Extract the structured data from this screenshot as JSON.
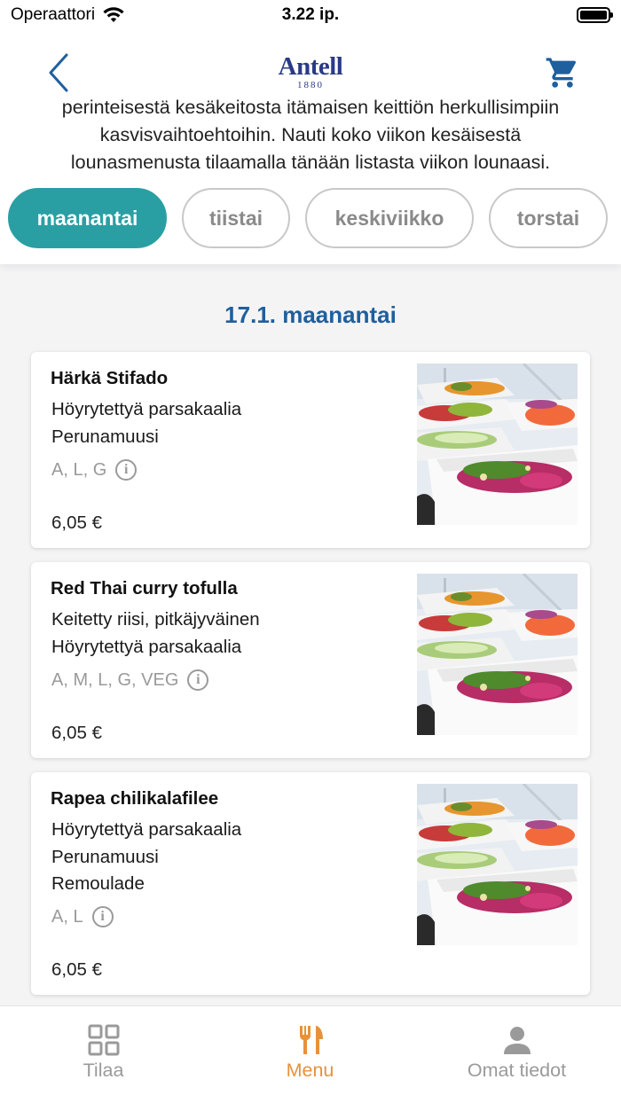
{
  "status_bar": {
    "carrier": "Operaattori",
    "time": "3.22 ip."
  },
  "header": {
    "logo_name": "Antell",
    "logo_year": "1880",
    "intro_lines": [
      "perinteisestä kesäkeitosta itämaisen keittiön herkullisimpiin",
      "kasvisvaihtoehtoihin. Nauti koko viikon kesäisestä",
      "lounasmenusta tilaamalla tänään listasta viikon lounaasi."
    ]
  },
  "tabs": [
    {
      "label": "maanantai",
      "active": true
    },
    {
      "label": "tiistai",
      "active": false
    },
    {
      "label": "keskiviikko",
      "active": false
    },
    {
      "label": "torstai",
      "active": false
    }
  ],
  "content": {
    "date_heading": "17.1. maanantai",
    "dishes": [
      {
        "title": "Härkä Stifado",
        "sides": [
          "Höyrytettyä parsakaalia",
          "Perunamuusi"
        ],
        "allergens": "A, L, G",
        "price": "6,05 €"
      },
      {
        "title": "Red Thai curry tofulla",
        "sides": [
          "Keitetty riisi, pitkäjyväinen",
          "Höyrytettyä parsakaalia"
        ],
        "allergens": "A, M, L, G, VEG",
        "price": "6,05 €"
      },
      {
        "title": "Rapea chilikalafilee",
        "sides": [
          "Höyrytettyä parsakaalia",
          "Perunamuusi",
          "Remoulade"
        ],
        "allergens": "A, L",
        "price": "6,05 €"
      }
    ]
  },
  "bottom_nav": {
    "items": [
      {
        "label": "Tilaa",
        "icon": "grid-icon",
        "active": false
      },
      {
        "label": "Menu",
        "icon": "fork-knife-icon",
        "active": true
      },
      {
        "label": "Omat tiedot",
        "icon": "person-icon",
        "active": false
      }
    ]
  },
  "colors": {
    "accent_teal": "#2a9fa3",
    "heading_blue": "#1f5f9e",
    "nav_active_orange": "#e8913a",
    "nav_inactive_gray": "#9a9a9a",
    "logo_navy": "#2a3a88"
  }
}
